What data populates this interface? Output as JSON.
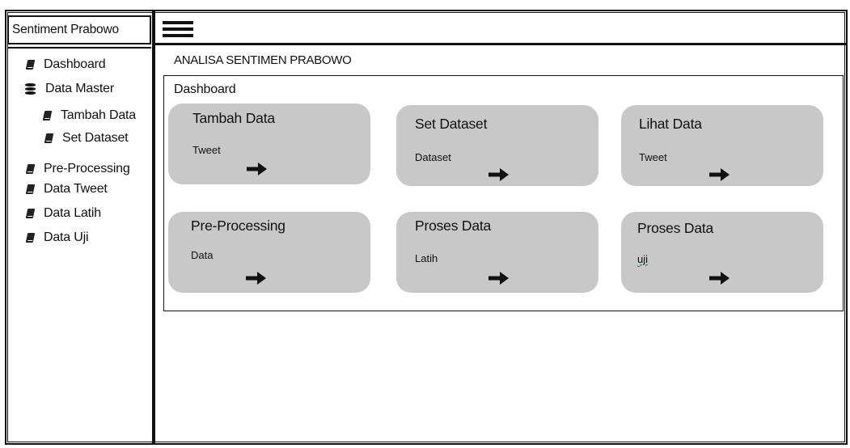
{
  "app": {
    "title": "Sentiment Prabowo"
  },
  "header": {
    "menu_icon": "hamburger-icon"
  },
  "sidebar": {
    "items": [
      {
        "label": "Dashboard",
        "icon": "book-icon"
      },
      {
        "label": "Data Master",
        "icon": "database-icon"
      },
      {
        "label": "Tambah Data",
        "icon": "book-icon"
      },
      {
        "label": "Set Dataset",
        "icon": "book-icon"
      },
      {
        "label": "Pre-Processing",
        "icon": "book-icon"
      },
      {
        "label": "Data Tweet",
        "icon": "book-icon"
      },
      {
        "label": "Data Latih",
        "icon": "book-icon"
      },
      {
        "label": "Data Uji",
        "icon": "book-icon"
      }
    ]
  },
  "main": {
    "page_title": "ANALISA SENTIMEN PRABOWO",
    "panel_title": "Dashboard",
    "cards": [
      {
        "title": "Tambah Data",
        "subtitle": "Tweet",
        "icon": "arrow-right-icon"
      },
      {
        "title": "Set Dataset",
        "subtitle": "Dataset",
        "icon": "arrow-right-icon"
      },
      {
        "title": "Lihat Data",
        "subtitle": "Tweet",
        "icon": "arrow-right-icon"
      },
      {
        "title": "Pre-Processing",
        "subtitle": "Data",
        "icon": "arrow-right-icon"
      },
      {
        "title": "Proses Data",
        "subtitle": "Latih",
        "icon": "arrow-right-icon"
      },
      {
        "title": "Proses Data",
        "subtitle": "uji",
        "icon": "arrow-right-icon"
      }
    ]
  },
  "colors": {
    "card_bg": "#c8c8c8",
    "border": "#111111"
  }
}
